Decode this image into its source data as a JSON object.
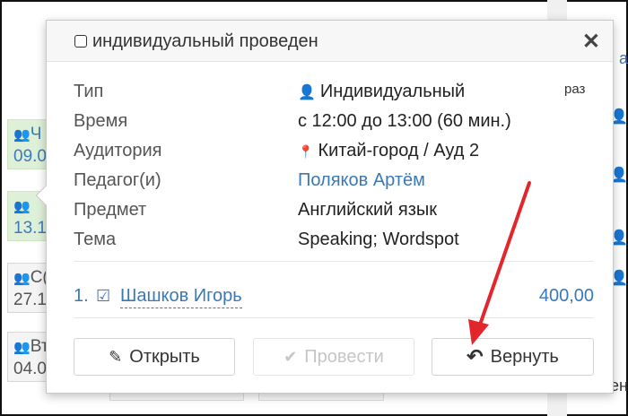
{
  "popup": {
    "title": "индивидуальный проведен",
    "close_glyph": "✕"
  },
  "details": [
    {
      "label": "Тип",
      "value": "Индивидуальный",
      "icon": "person-icon",
      "glyph": "👤"
    },
    {
      "label": "Время",
      "value": "с 12:00 до 13:00 (60 мин.)"
    },
    {
      "label": "Аудитория",
      "value": "Китай-город / Ауд 2",
      "icon": "map-marker-icon",
      "glyph": "📍"
    },
    {
      "label": "Педагог(и)",
      "value": "Поляков Артём",
      "is_link": true
    },
    {
      "label": "Предмет",
      "value": "Английский язык"
    },
    {
      "label": "Тема",
      "value": "Speaking; Wordspot"
    }
  ],
  "side_note": "раз",
  "students": [
    {
      "number": "1.",
      "name": "Шашков Игорь",
      "amount": "400,00",
      "icon": "check-circle-icon",
      "glyph": "☑"
    }
  ],
  "buttons": {
    "open": {
      "label": "Открыть",
      "icon": "edit-icon",
      "glyph": "✎"
    },
    "conduct": {
      "label": "Провести",
      "icon": "check-icon",
      "glyph": "✔",
      "disabled": true
    },
    "return": {
      "label": "Вернуть",
      "icon": "undo-icon",
      "glyph": "↶"
    }
  },
  "background": {
    "cells": [
      {
        "line1": "Ч",
        "line2": "09.0"
      },
      {
        "line1": "",
        "line2": "13.1"
      },
      {
        "line1": "С(",
        "line2": "27.1"
      },
      {
        "line1": "Вт",
        "line2": "04.0"
      }
    ],
    "right_edge_text": [
      "а",
      "Г",
      "Ген"
    ]
  },
  "colors": {
    "link": "#3a78b8",
    "green_cell": "#dff0d8",
    "annotation_arrow": "#e3262b"
  }
}
